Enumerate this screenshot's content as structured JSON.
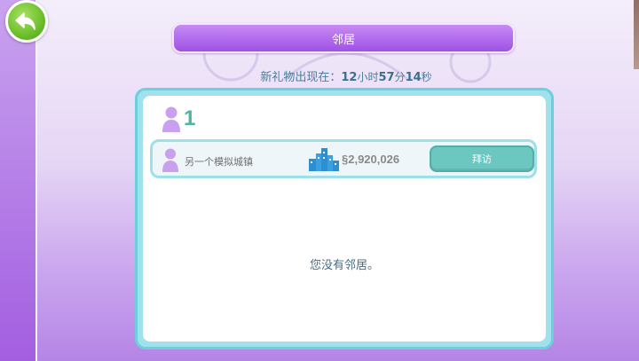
{
  "header": {
    "title": "邻居"
  },
  "gift_timer": {
    "prefix": "新礼物出现在：",
    "hours": "12",
    "hours_unit": "小时",
    "minutes": "57",
    "minutes_unit": "分",
    "seconds": "14",
    "seconds_unit": "秒"
  },
  "neighbors": {
    "count": "1",
    "rows": [
      {
        "name": "另一个模拟城镇",
        "money": "§2,920,026",
        "visit_label": "拜访"
      }
    ],
    "empty_message": "您没有邻居。"
  },
  "icons": {
    "back": "back-arrow-icon",
    "person": "person-icon",
    "city": "city-buildings-icon"
  },
  "colors": {
    "accent_purple": "#9e52e6",
    "teal_button": "#6bc7bf",
    "panel_border": "#6ccfdd",
    "back_green": "#6cbe2b"
  }
}
